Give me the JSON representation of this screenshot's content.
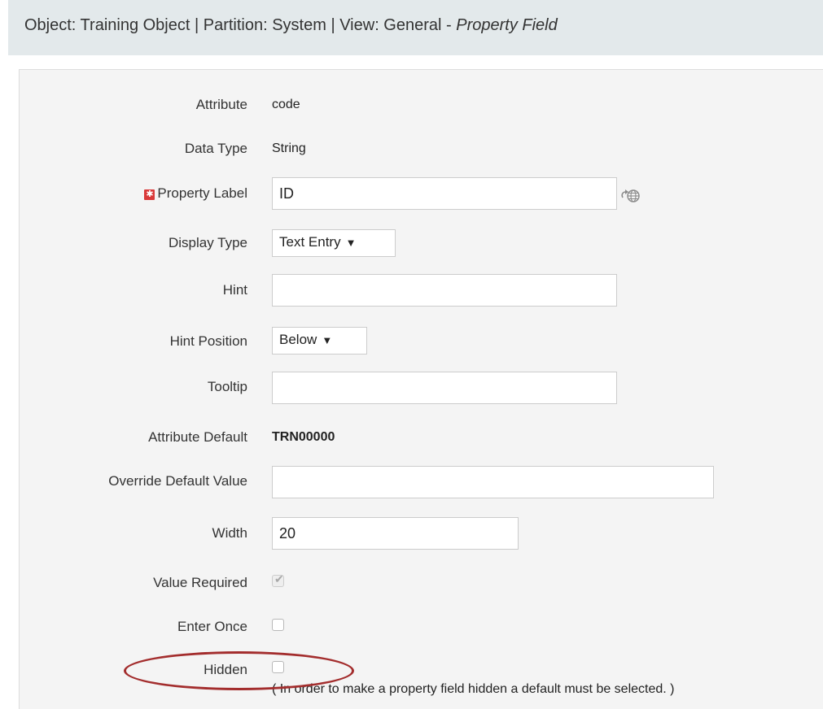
{
  "header": {
    "prefix": "Object: Training Object | Partition: System | View: General - ",
    "italic": "Property Field"
  },
  "form": {
    "attribute": {
      "label": "Attribute",
      "value": "code"
    },
    "data_type": {
      "label": "Data Type",
      "value": "String"
    },
    "property_label": {
      "label": "Property Label",
      "value": "ID",
      "required_icon": "required-asterisk-icon",
      "globe_icon": "globe-icon"
    },
    "display_type": {
      "label": "Display Type",
      "value": "Text Entry",
      "caret": "▼"
    },
    "hint": {
      "label": "Hint",
      "value": ""
    },
    "hint_position": {
      "label": "Hint Position",
      "value": "Below",
      "caret": "▼"
    },
    "tooltip": {
      "label": "Tooltip",
      "value": ""
    },
    "attribute_default": {
      "label": "Attribute Default",
      "value": "TRN00000"
    },
    "override_default_value": {
      "label": "Override Default Value",
      "value": ""
    },
    "width": {
      "label": "Width",
      "value": "20"
    },
    "value_required": {
      "label": "Value Required",
      "checked": true,
      "disabled": true
    },
    "enter_once": {
      "label": "Enter Once",
      "checked": false
    },
    "hidden": {
      "label": "Hidden",
      "checked": false,
      "note": "( In order to make a property field hidden a default must be selected. )"
    }
  },
  "colors": {
    "header_bg": "#e3e9eb",
    "panel_bg": "#f4f4f4",
    "required_red": "#d93a3a",
    "annotation_ellipse": "#a32d2d"
  }
}
